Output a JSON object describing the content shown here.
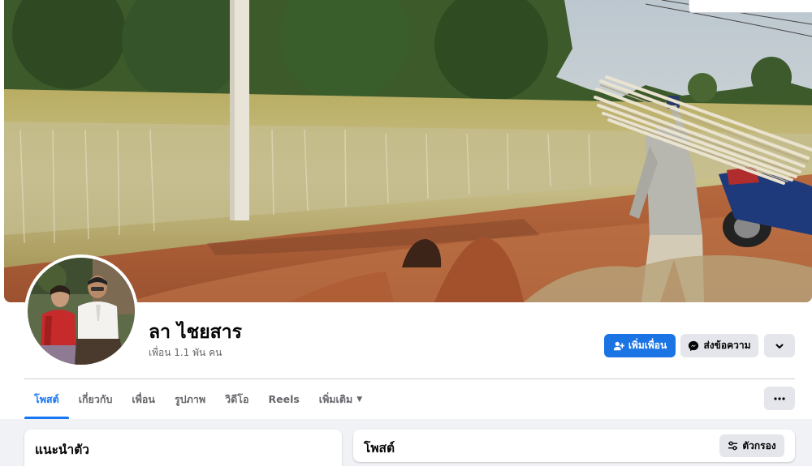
{
  "profile": {
    "name": "ลา ไชยสาร",
    "friend_count": "เพื่อน 1.1 พัน คน"
  },
  "actions": {
    "add_friend": "เพิ่มเพื่อน",
    "message": "ส่งข้อความ"
  },
  "tabs": [
    {
      "label": "โพสต์",
      "active": true
    },
    {
      "label": "เกี่ยวกับ",
      "active": false
    },
    {
      "label": "เพื่อน",
      "active": false
    },
    {
      "label": "รูปภาพ",
      "active": false
    },
    {
      "label": "วิดีโอ",
      "active": false
    },
    {
      "label": "Reels",
      "active": false
    },
    {
      "label": "เพิ่มเติม",
      "active": false
    }
  ],
  "intro": {
    "title": "แนะนำตัว"
  },
  "posts": {
    "title": "โพสต์",
    "filter_label": "ตัวกรอง"
  },
  "icons": {
    "add_friend": "person-plus-icon",
    "message": "messenger-icon",
    "more": "chevron-down-icon",
    "tab_more": "caret-down-icon",
    "overflow": "ellipsis-icon",
    "filter": "sliders-icon"
  },
  "colors": {
    "accent": "#1877f2",
    "primary_button": "#1b74e4",
    "secondary_button": "#e4e6eb",
    "page_background": "#f0f2f5",
    "muted_text": "#65676b"
  }
}
